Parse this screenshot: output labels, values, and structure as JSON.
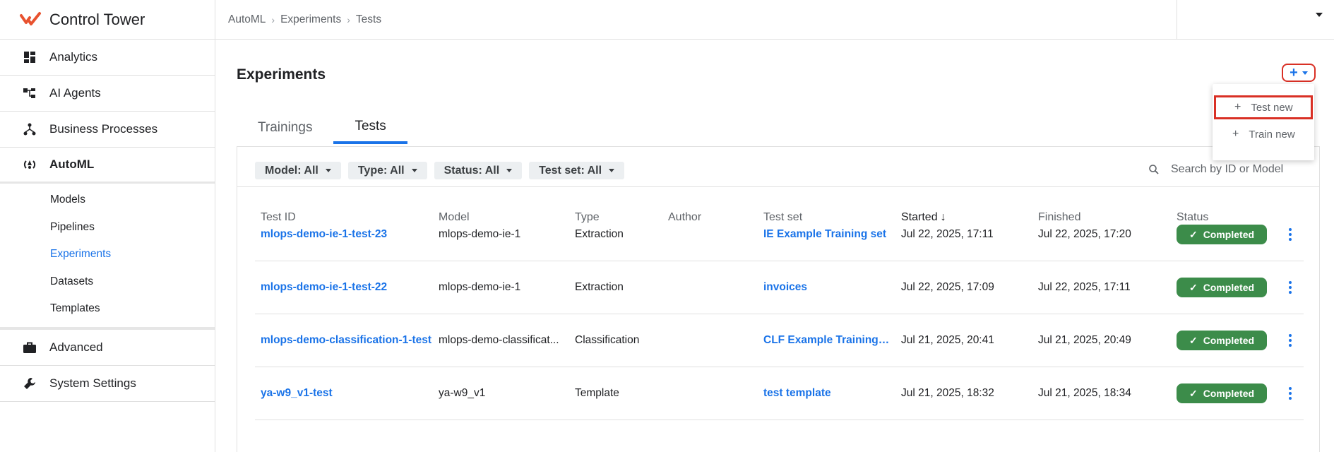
{
  "app": {
    "title": "Control Tower"
  },
  "nav": [
    {
      "label": "Analytics",
      "icon": "dashboard-icon"
    },
    {
      "label": "AI Agents",
      "icon": "hierarchy-icon"
    },
    {
      "label": "Business Processes",
      "icon": "process-icon"
    },
    {
      "label": "AutoML",
      "icon": "automl-icon"
    }
  ],
  "subnav": [
    "Models",
    "Pipelines",
    "Experiments",
    "Datasets",
    "Templates"
  ],
  "nav_bottom": [
    {
      "label": "Advanced",
      "icon": "briefcase-icon"
    },
    {
      "label": "System Settings",
      "icon": "wrench-icon"
    }
  ],
  "breadcrumb": [
    "AutoML",
    "Experiments",
    "Tests"
  ],
  "page": {
    "title": "Experiments"
  },
  "tabs": [
    "Trainings",
    "Tests"
  ],
  "filters": [
    "Model: All",
    "Type: All",
    "Status: All",
    "Test set: All"
  ],
  "search": {
    "placeholder": "Search by ID or Model"
  },
  "table": {
    "headers": [
      "Test ID",
      "Model",
      "Type",
      "Author",
      "Test set",
      "Started",
      "Finished",
      "Status"
    ],
    "rows": [
      {
        "id": "mlops-demo-ie-1-test-23",
        "model": "mlops-demo-ie-1",
        "type": "Extraction",
        "author": "",
        "test_set": "IE Example Training set",
        "started": "Jul 22, 2025, 17:11",
        "finished": "Jul 22, 2025, 17:20",
        "status": "Completed"
      },
      {
        "id": "mlops-demo-ie-1-test-22",
        "model": "mlops-demo-ie-1",
        "type": "Extraction",
        "author": "",
        "test_set": "invoices",
        "started": "Jul 22, 2025, 17:09",
        "finished": "Jul 22, 2025, 17:11",
        "status": "Completed"
      },
      {
        "id": "mlops-demo-classification-1-test",
        "model": "mlops-demo-classificat...",
        "type": "Classification",
        "author": "",
        "test_set": "CLF Example Training s...",
        "started": "Jul 21, 2025, 20:41",
        "finished": "Jul 21, 2025, 20:49",
        "status": "Completed"
      },
      {
        "id": "ya-w9_v1-test",
        "model": "ya-w9_v1",
        "type": "Template",
        "author": "",
        "test_set": "test template",
        "started": "Jul 21, 2025, 18:32",
        "finished": "Jul 21, 2025, 18:34",
        "status": "Completed"
      }
    ]
  },
  "menu": {
    "items": [
      "Test new",
      "Train new"
    ]
  },
  "colors": {
    "accent": "#1a73e8",
    "brand": "#e8522f",
    "success": "#3c8c4a",
    "highlight": "#d93025"
  }
}
